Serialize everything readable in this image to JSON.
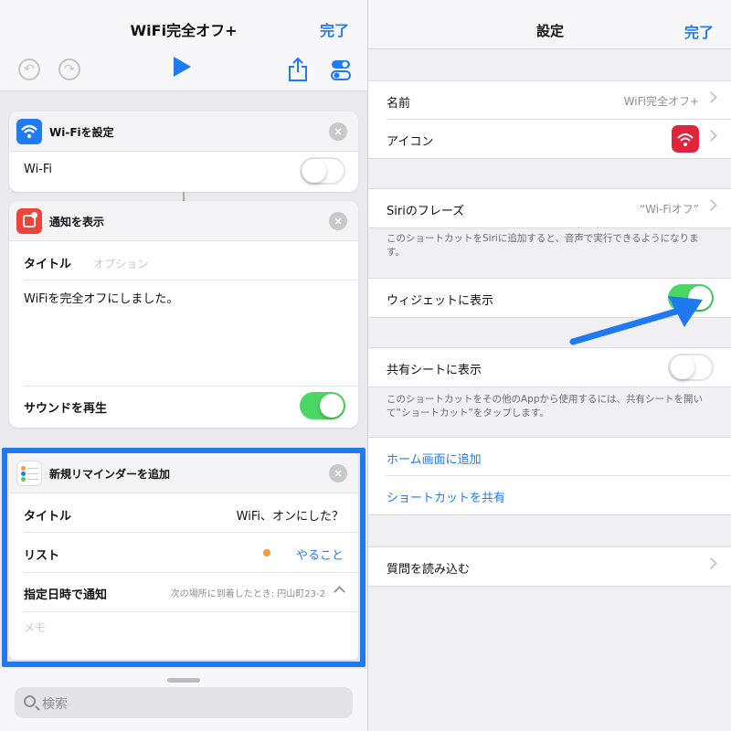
{
  "left": {
    "title": "WiFi完全オフ+",
    "done": "完了",
    "cards": {
      "wifi": {
        "title": "Wi-Fiを設定",
        "row_label": "Wi-Fi",
        "toggle_on": false
      },
      "notify": {
        "title": "通知を表示",
        "title_label": "タイトル",
        "title_placeholder": "オプション",
        "body": "WiFiを完全オフにしました。",
        "sound_label": "サウンドを再生",
        "sound_on": true
      },
      "reminder": {
        "title": "新規リマインダーを追加",
        "title_label": "タイトル",
        "title_value": "WiFi、オンにした？",
        "list_label": "リスト",
        "list_value": "やること",
        "notify_label": "指定日時で通知",
        "notify_value": "次の場所に到着したとき: 円山町23-2",
        "memo_placeholder": "メモ"
      }
    },
    "search_placeholder": "検索"
  },
  "right": {
    "title": "設定",
    "done": "完了",
    "name_label": "名前",
    "name_value": "WiFi完全オフ+",
    "icon_label": "アイコン",
    "siri_label": "Siriのフレーズ",
    "siri_value": "“Wi-Fiオフ”",
    "siri_note": "このショートカットをSiriに追加すると、音声で実行できるようになります。",
    "widget_label": "ウィジェットに表示",
    "widget_on": true,
    "share_sheet_label": "共有シートに表示",
    "share_sheet_on": false,
    "share_note": "このショートカットをその他のAppから使用するには、共有シートを開いて“ショートカット”をタップします。",
    "home_link": "ホーム画面に追加",
    "share_link": "ショートカットを共有",
    "import_label": "質問を読み込む"
  },
  "colors": {
    "accent": "#1e7cf2",
    "switch_on": "#4bd763",
    "highlight": "#1f79f0",
    "app_icon": "#e0243b"
  }
}
